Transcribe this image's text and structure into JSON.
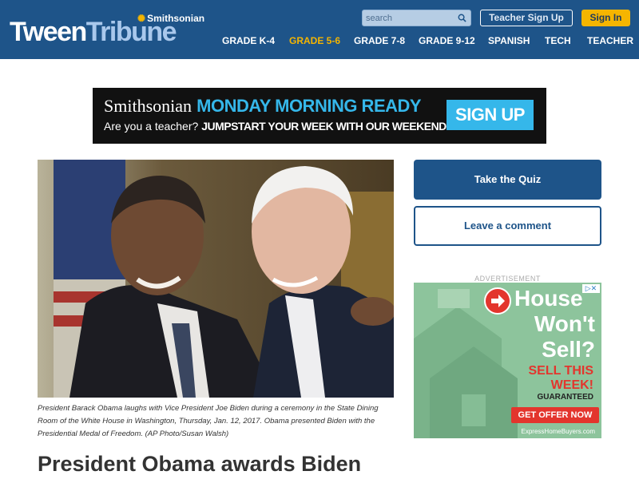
{
  "header": {
    "logo": {
      "tween": "Tween",
      "tribune": "Tribune",
      "smithsonian": "Smithsonian"
    },
    "search": {
      "placeholder": "search"
    },
    "teacher_signup": "Teacher Sign Up",
    "signin": "Sign In",
    "nav": [
      {
        "label": "GRADE K-4"
      },
      {
        "label": "GRADE 5-6",
        "active": true
      },
      {
        "label": "GRADE 7-8"
      },
      {
        "label": "GRADE 9-12"
      },
      {
        "label": "SPANISH"
      },
      {
        "label": "TECH"
      },
      {
        "label": "TEACHER"
      }
    ]
  },
  "banner": {
    "smithsonian": "Smithsonian",
    "title": "MONDAY MORNING READY",
    "question": "Are you a teacher?",
    "tagline": "JUMPSTART YOUR WEEK WITH OUR WEEKEND NEWSLETTER!",
    "button": "SIGN UP"
  },
  "article": {
    "caption": "President Barack Obama laughs with Vice President Joe Biden during a ceremony in the State Dining Room of the White House in Washington, Thursday, Jan. 12, 2017. Obama presented Biden with the Presidential Medal of Freedom. (AP Photo/Susan Walsh)",
    "headline": "President Obama awards Biden"
  },
  "sidebar": {
    "quiz": "Take the Quiz",
    "comment": "Leave a comment",
    "ad_label": "ADVERTISEMENT",
    "ad": {
      "line1": "House",
      "line2": "Won't",
      "line3": "Sell?",
      "line4": "SELL THIS",
      "line5": "WEEK!",
      "line6": "GUARANTEED",
      "cta": "GET OFFER NOW",
      "brand": "ExpressHomeBuyers.com"
    }
  },
  "colors": {
    "header_bg": "#1e5489",
    "accent_yellow": "#f5b500",
    "banner_blue": "#35b7ea",
    "ad_green": "#8dc49c",
    "ad_red": "#e3352d"
  }
}
